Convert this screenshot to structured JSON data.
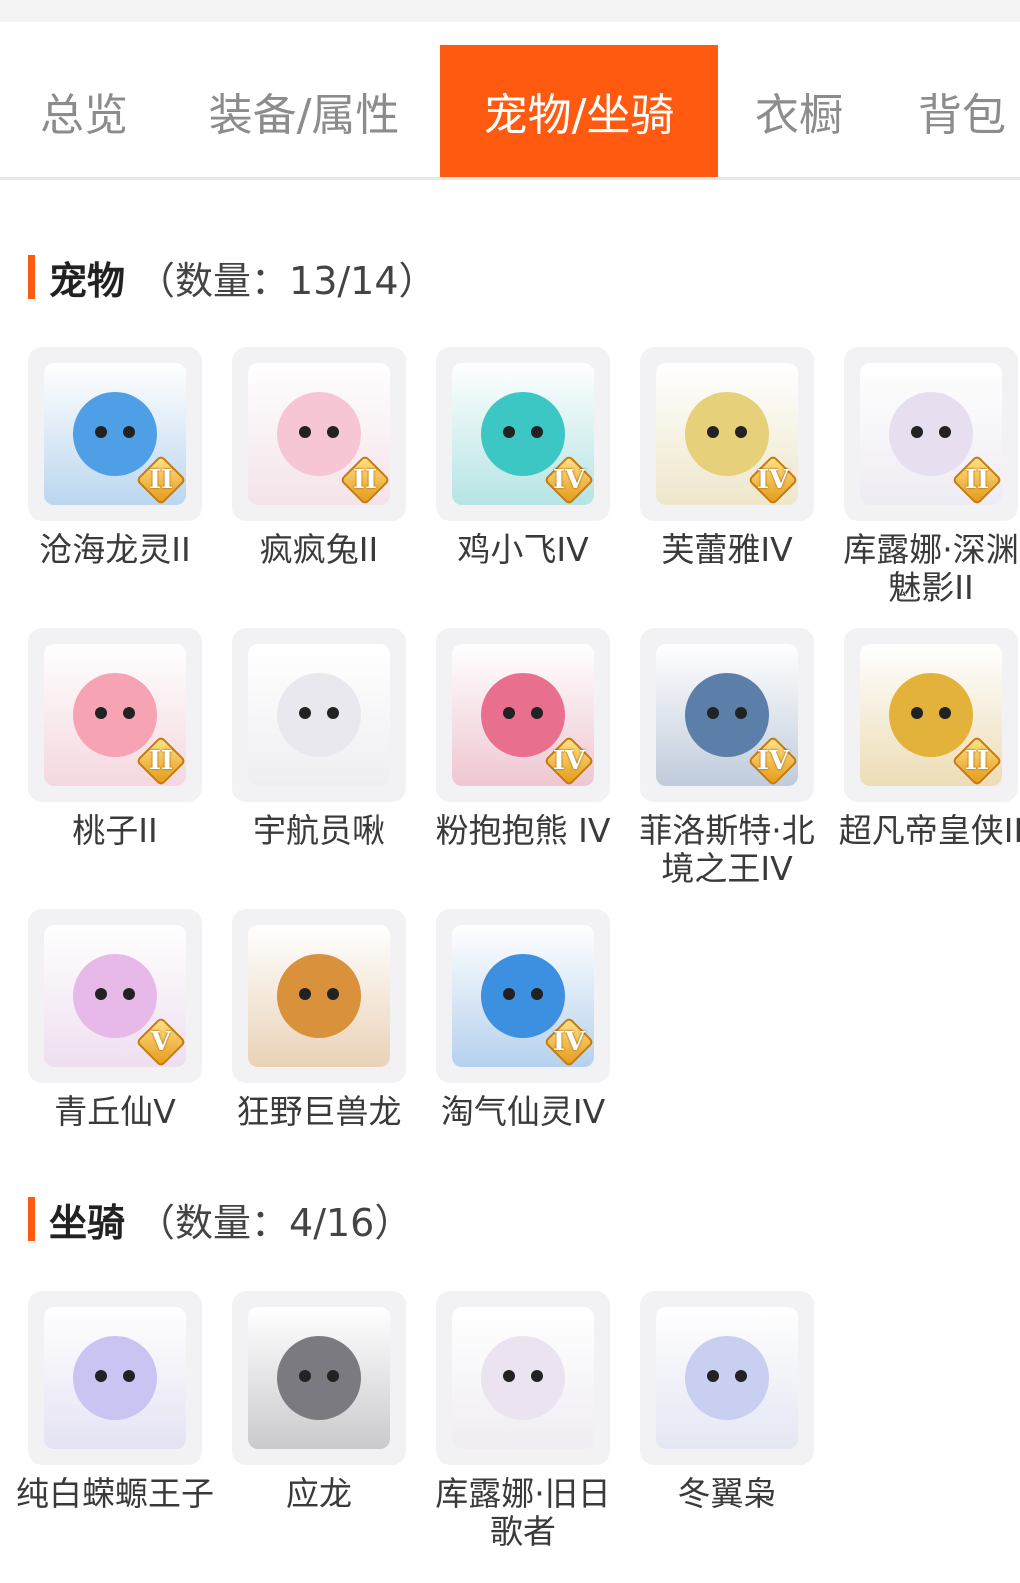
{
  "tabs": [
    {
      "label": "总览"
    },
    {
      "label": "装备/属性"
    },
    {
      "label": "宠物/坐骑"
    },
    {
      "label": "衣橱"
    },
    {
      "label": "背包"
    }
  ],
  "active_tab": "宠物/坐骑",
  "accent_color": "#ff5a10",
  "pets": {
    "title": "宠物",
    "count_text": "（数量：13/14）",
    "items": [
      {
        "name": "沧海龙灵II",
        "badge": "II",
        "color": "#4f9fe6"
      },
      {
        "name": "疯疯兔II",
        "badge": "II",
        "color": "#f7c6d4"
      },
      {
        "name": "鸡小飞IV",
        "badge": "IV",
        "color": "#3cc7c4"
      },
      {
        "name": "芙蕾雅IV",
        "badge": "IV",
        "color": "#e6d07a"
      },
      {
        "name": "库露娜·深渊魅影II",
        "badge": "II",
        "color": "#e7dff0"
      },
      {
        "name": "桃子II",
        "badge": "II",
        "color": "#f6a4b4"
      },
      {
        "name": "宇航员啾",
        "badge": "",
        "color": "#e8e8ee"
      },
      {
        "name": "粉抱抱熊 IV",
        "badge": "IV",
        "color": "#e86f8e"
      },
      {
        "name": "菲洛斯特·北境之王IV",
        "badge": "IV",
        "color": "#5b7fa8"
      },
      {
        "name": "超凡帝皇侠II",
        "badge": "II",
        "color": "#e3b23a"
      },
      {
        "name": "青丘仙V",
        "badge": "V",
        "color": "#e7b9e8"
      },
      {
        "name": "狂野巨兽龙",
        "badge": "",
        "color": "#d9913b"
      },
      {
        "name": "淘气仙灵IV",
        "badge": "IV",
        "color": "#3d8fe0"
      }
    ]
  },
  "mounts": {
    "title": "坐骑",
    "count_text": "（数量：4/16）",
    "items": [
      {
        "name": "纯白蝾螈王子",
        "badge": "",
        "color": "#c9c4f2"
      },
      {
        "name": "应龙",
        "badge": "",
        "color": "#7a7a80"
      },
      {
        "name": "库露娜·旧日歌者",
        "badge": "",
        "color": "#ebe3f0"
      },
      {
        "name": "冬翼枭",
        "badge": "",
        "color": "#c8cff0"
      }
    ]
  }
}
